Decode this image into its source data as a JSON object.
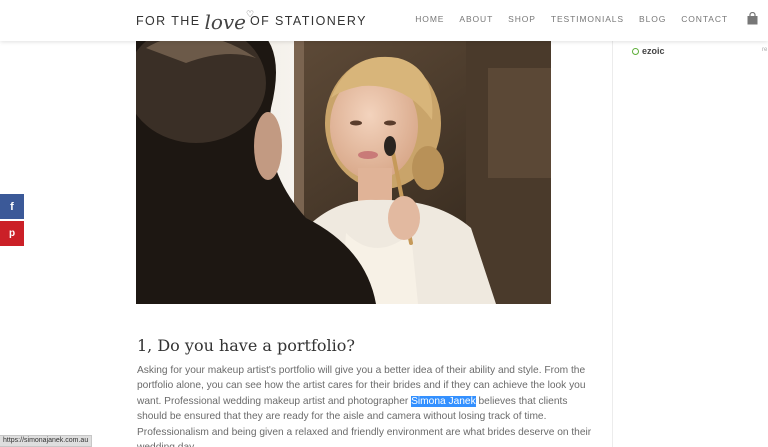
{
  "header": {
    "logo": {
      "part1": "FOR THE",
      "script": "love",
      "part2": "OF STATIONERY"
    },
    "nav": [
      "HOME",
      "ABOUT",
      "SHOP",
      "TESTIMONIALS",
      "BLOG",
      "CONTACT"
    ]
  },
  "article": {
    "heading": "1, Do you have a portfolio?",
    "body_before": "Asking for your makeup artist's portfolio will give you a better idea of their ability and style. From the portfolio alone, you can see how the artist cares for their brides and if they can achieve the look you want. Professional wedding makeup artist and photographer ",
    "link_text": "Simona Janek",
    "body_after": " believes that clients should be ensured that they are ready for the aisle and camera without losing track of time. Professionalism and being given a relaxed and friendly environment are what brides deserve on their wedding day."
  },
  "sidebar": {
    "ad_brand": "ezoic",
    "fragment": "re"
  },
  "share": {
    "facebook": "f",
    "pinterest": "p"
  },
  "status_url": "https://simonajanek.com.au",
  "colors": {
    "facebook": "#3b5998",
    "pinterest": "#cb2027",
    "selection": "#3390ff"
  }
}
